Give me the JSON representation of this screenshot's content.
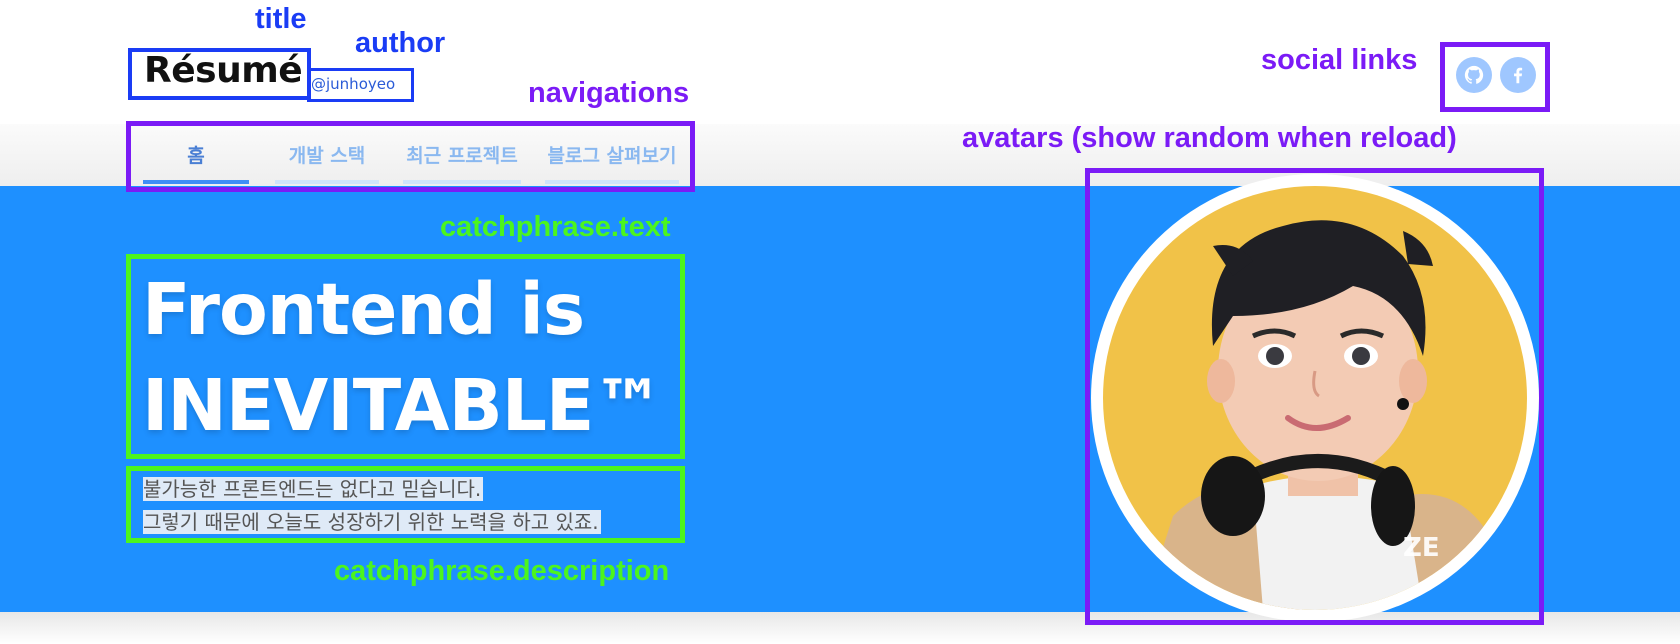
{
  "annotations": {
    "title": "title",
    "author": "author",
    "navigations": "navigations",
    "social_links": "social links",
    "avatars": "avatars (show random when reload)",
    "catchphrase_text": "catchphrase.text",
    "catchphrase_description": "catchphrase.description"
  },
  "header": {
    "title": "Résumé",
    "author": "@junhoyeo"
  },
  "social": [
    {
      "icon": "github-icon"
    },
    {
      "icon": "facebook-icon"
    }
  ],
  "nav": [
    {
      "label": "홈",
      "active": true
    },
    {
      "label": "개발 스택",
      "active": false
    },
    {
      "label": "최근 프로젝트",
      "active": false
    },
    {
      "label": "블로그 살펴보기",
      "active": false
    }
  ],
  "catchphrase": {
    "text_line1": "Frontend is",
    "text_line2": "INEVITABLE™",
    "description_line1": "불가능한 프론트엔드는 없다고 믿습니다.",
    "description_line2": "그렇기 때문에 오늘도 성장하기 위한 노력을 하고 있죠."
  },
  "avatar": {
    "watermark": "ZE"
  },
  "colors": {
    "hero": "#1e90ff",
    "annotation_blue": "#1a3cf5",
    "annotation_purple": "#7b1bf6",
    "annotation_green": "#4cf51e",
    "nav_active": "#3f8ef6"
  }
}
